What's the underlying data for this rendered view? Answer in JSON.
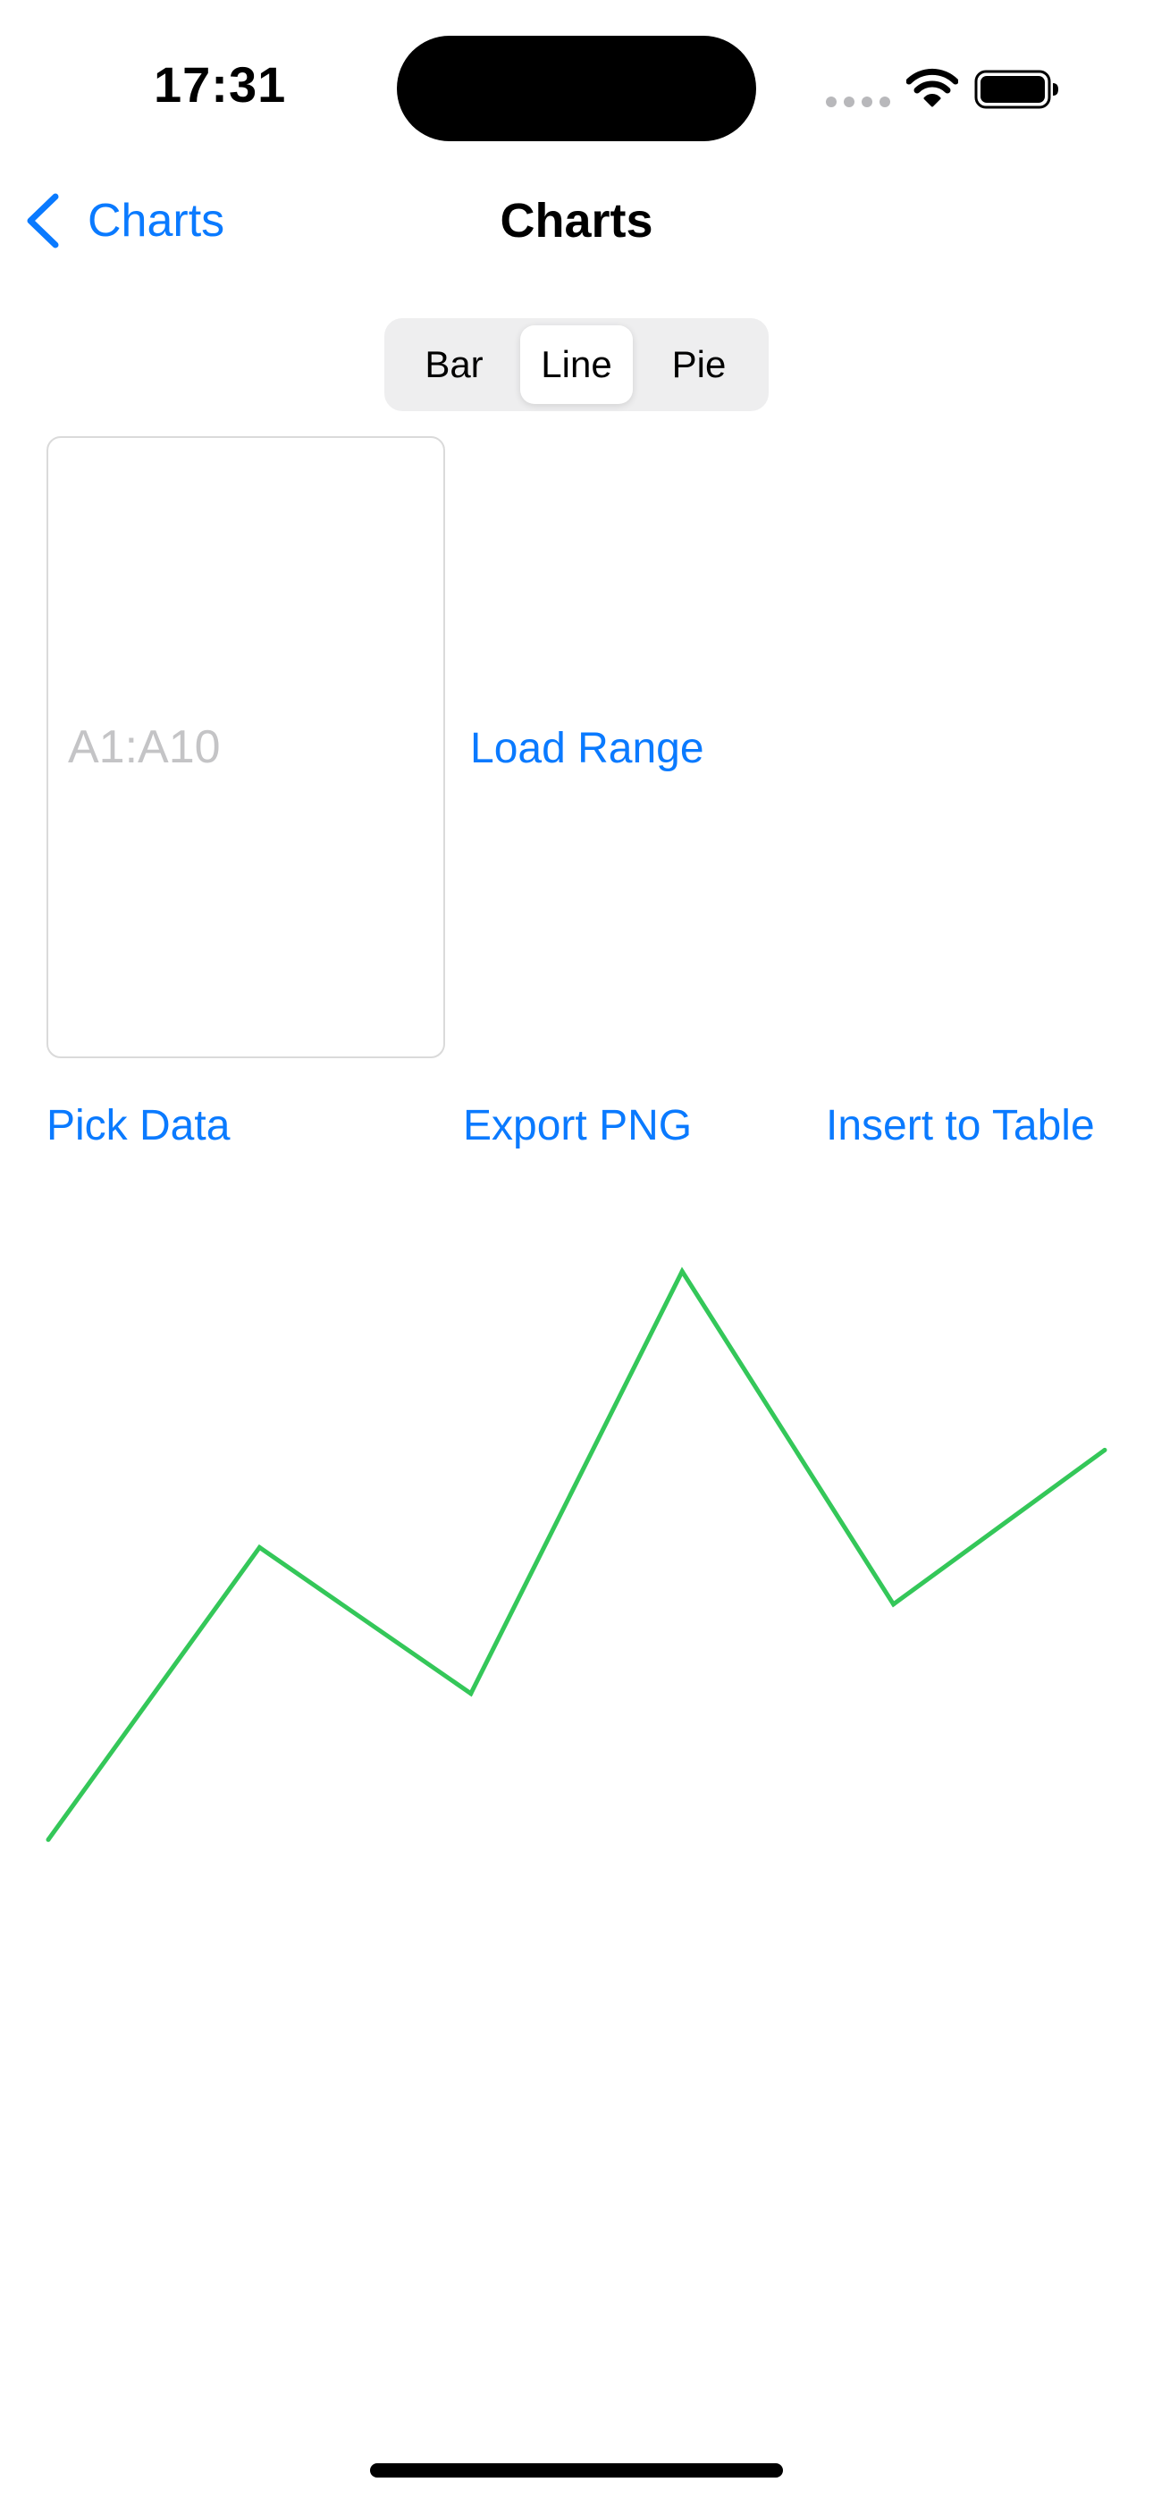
{
  "status_bar": {
    "time": "17:31",
    "icons": [
      "cellular-signal-icon",
      "wifi-icon",
      "battery-icon"
    ]
  },
  "nav": {
    "back_label": "Charts",
    "title": "Charts"
  },
  "segmented_control": {
    "options": [
      "Bar",
      "Line",
      "Pie"
    ],
    "selected": "Line"
  },
  "range_input": {
    "value": "",
    "placeholder": "A1:A10"
  },
  "buttons": {
    "load_range": "Load Range",
    "pick_data": "Pick Data",
    "export_png": "Export PNG",
    "insert_to_table": "Insert to Table"
  },
  "colors": {
    "accent": "#0A7AFF",
    "line": "#34C759"
  },
  "chart_data": {
    "type": "line",
    "title": "",
    "xlabel": "",
    "ylabel": "",
    "grid": false,
    "legend": "none",
    "x": [
      1,
      2,
      3,
      4,
      5,
      6
    ],
    "values": [
      2,
      5.6,
      3.8,
      9,
      4.9,
      6.8
    ],
    "ylim": [
      0,
      9.6
    ]
  }
}
